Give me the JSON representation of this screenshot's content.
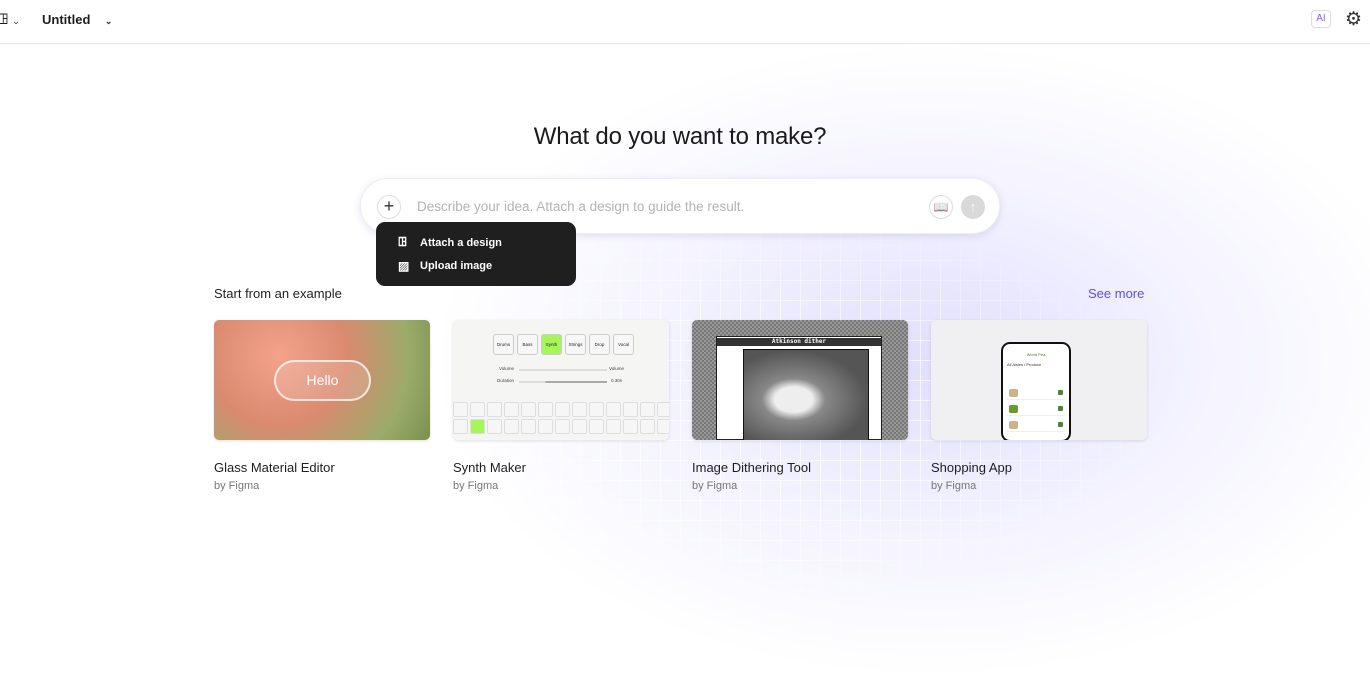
{
  "header": {
    "title": "Untitled",
    "ai_badge": "AI"
  },
  "main": {
    "heading": "What do you want to make?",
    "prompt": {
      "placeholder": "Describe your idea. Attach a design to guide the result."
    },
    "attach_menu": [
      {
        "label": "Attach a design",
        "icon": "figma-frame-icon"
      },
      {
        "label": "Upload image",
        "icon": "image-icon"
      }
    ],
    "examples_label": "Start from an example",
    "see_more": "See more",
    "examples": [
      {
        "name": "Glass Material Editor",
        "by": "by Figma",
        "preview_text": "Hello"
      },
      {
        "name": "Synth Maker",
        "by": "by Figma",
        "preview_tabs": [
          "Drums",
          "Bass",
          "Synth",
          "Strings",
          "Drop",
          "Vocal"
        ],
        "preview_volume": "Volume",
        "preview_duration": "Duration",
        "preview_duration_value": "0.30s"
      },
      {
        "name": "Image Dithering Tool",
        "by": "by Figma",
        "preview_title": "Atkinson dither"
      },
      {
        "name": "Shopping App",
        "by": "by Figma",
        "preview_title": "World Pea",
        "preview_subtitle": "All Aisles / Produce"
      }
    ]
  },
  "colors": {
    "accent": "#5a4fe0",
    "menu_bg": "#1f1f1f",
    "synth_green": "#a6f55a"
  }
}
